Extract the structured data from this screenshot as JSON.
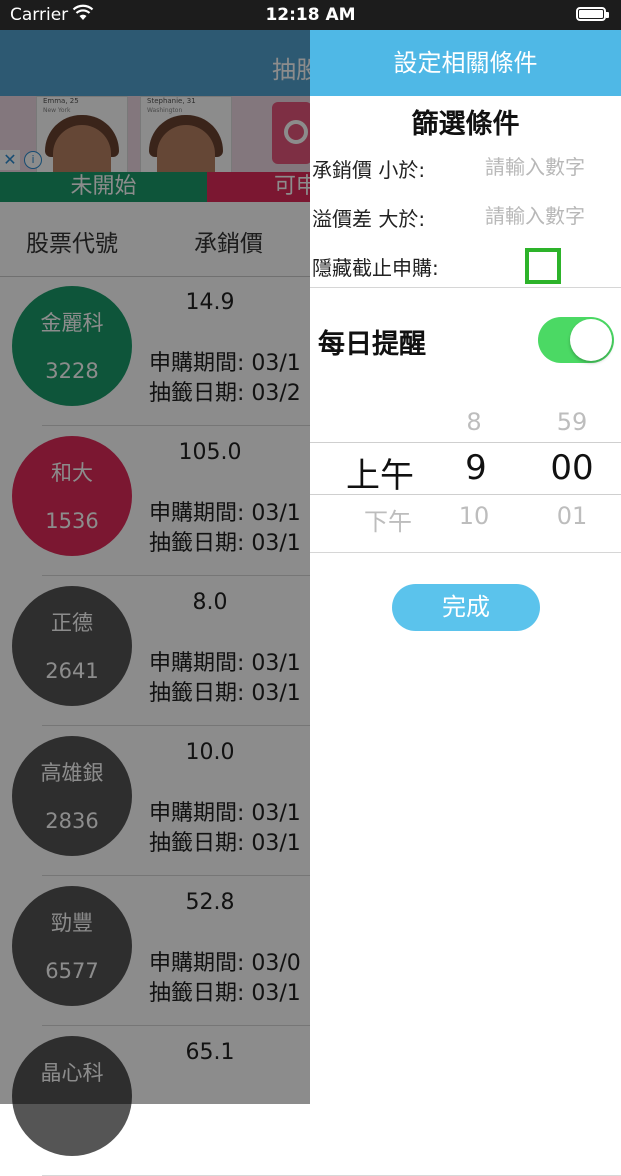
{
  "status_bar": {
    "carrier": "Carrier",
    "time": "12:18 AM"
  },
  "underlying": {
    "nav_title": "抽股",
    "ad": {
      "card1_name": "Emma, 25",
      "card1_loc": "New York",
      "card2_name": "Stephanie, 31",
      "card2_loc": "Washington",
      "close_glyph": "✕",
      "info_glyph": "i"
    },
    "tabs": {
      "not_started": "未開始",
      "open": "可申"
    },
    "headers": {
      "code": "股票代號",
      "price": "承銷價"
    },
    "rows": [
      {
        "name": "金麗科",
        "code": "3228",
        "price": "14.9",
        "period": "申購期間: 03/1",
        "draw": "抽籤日期: 03/2",
        "color": "#1a9c6a"
      },
      {
        "name": "和大",
        "code": "1536",
        "price": "105.0",
        "period": "申購期間: 03/1",
        "draw": "抽籤日期: 03/1",
        "color": "#e02b5a"
      },
      {
        "name": "正德",
        "code": "2641",
        "price": "8.0",
        "period": "申購期間: 03/1",
        "draw": "抽籤日期: 03/1",
        "color": "#555555"
      },
      {
        "name": "高雄銀",
        "code": "2836",
        "price": "10.0",
        "period": "申購期間: 03/1",
        "draw": "抽籤日期: 03/1",
        "color": "#555555"
      },
      {
        "name": "勁豐",
        "code": "6577",
        "price": "52.8",
        "period": "申購期間: 03/0",
        "draw": "抽籤日期: 03/1",
        "color": "#555555"
      },
      {
        "name": "晶心科",
        "code": "",
        "price": "65.1",
        "period": "",
        "draw": "",
        "color": "#555555"
      }
    ]
  },
  "panel": {
    "nav_title": "設定相關條件",
    "filter_title": "篩選條件",
    "price_label": "承銷價 小於:",
    "price_placeholder": "請輸入數字",
    "premium_label": "溢價差 大於:",
    "premium_placeholder": "請輸入數字",
    "hide_label": "隱藏截止申購:",
    "hide_checked": false,
    "daily_reminder_label": "每日提醒",
    "daily_reminder_on": true,
    "picker": {
      "ampm": {
        "selected": "上午",
        "below": "下午"
      },
      "hour": {
        "above": "8",
        "selected": "9",
        "below": "10"
      },
      "minute": {
        "above": "59",
        "selected": "00",
        "below": "01"
      }
    },
    "done_label": "完成"
  },
  "colors": {
    "nav_blue": "#52a3cf",
    "panel_header": "#4fb8e6",
    "done_button": "#5bc3ec",
    "toggle_on": "#4bd964",
    "checkbox_border": "#2db32a"
  }
}
